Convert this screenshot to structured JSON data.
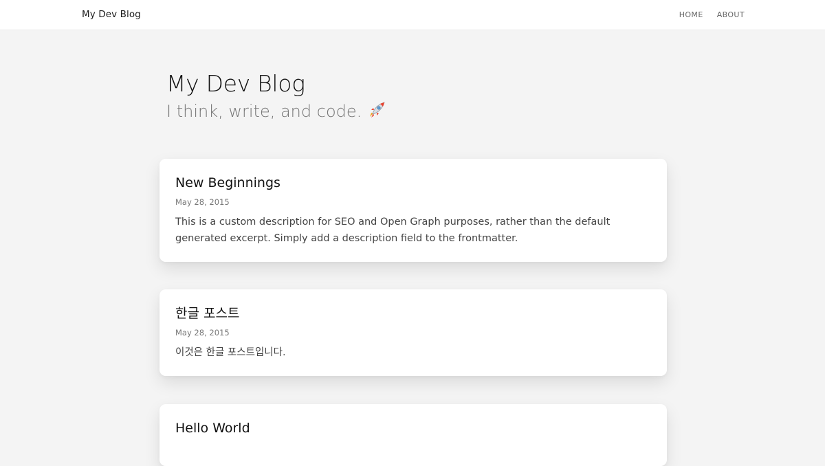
{
  "navbar": {
    "brand": "My Dev Blog",
    "links": [
      {
        "label": "HOME"
      },
      {
        "label": "ABOUT"
      }
    ]
  },
  "hero": {
    "title": "My Dev Blog",
    "subtitle": "I think, write, and code.",
    "emoji_icon": "rocket-icon"
  },
  "posts": [
    {
      "title": "New Beginnings",
      "date": "May 28, 2015",
      "description": "This is a custom description for SEO and Open Graph purposes, rather than the default generated excerpt. Simply add a description field to the frontmatter."
    },
    {
      "title": "한글 포스트",
      "date": "May 28, 2015",
      "description": "이것은 한글 포스트입니다."
    },
    {
      "title": "Hello World"
    }
  ],
  "colors": {
    "background": "#f4f4f4",
    "card": "#ffffff",
    "text": "#111111",
    "muted": "#777777"
  }
}
